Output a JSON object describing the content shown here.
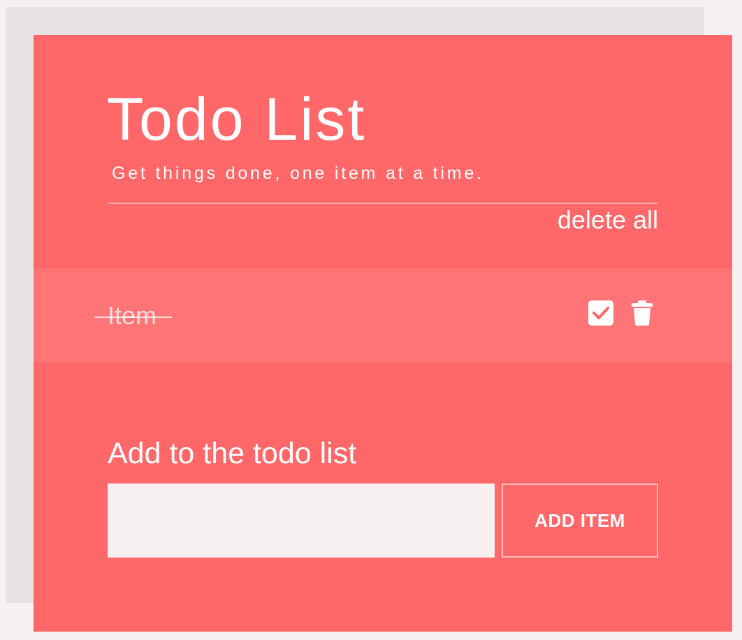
{
  "app": {
    "title": "Todo List",
    "subtitle": "Get things done, one item at a time."
  },
  "actions": {
    "delete_all_label": "delete all"
  },
  "todos": [
    {
      "text": "Item",
      "completed": true,
      "complete_icon": "checkbox-checked-icon",
      "delete_icon": "trash-icon"
    }
  ],
  "form": {
    "label": "Add to the todo list",
    "input_value": "",
    "input_placeholder": "",
    "button_label": "ADD ITEM"
  },
  "colors": {
    "card_background": "#ff6769",
    "item_background": "#ff7476",
    "page_background": "#f6f0f0",
    "shadow_card": "#e8e2e2",
    "text": "#ffffff"
  }
}
